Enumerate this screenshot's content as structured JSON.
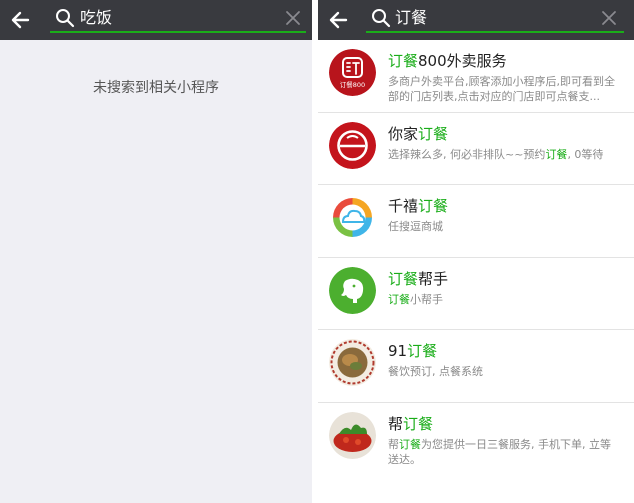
{
  "left": {
    "search": {
      "query": "吃饭"
    },
    "empty_message": "未搜索到相关小程序"
  },
  "right": {
    "search": {
      "query": "订餐"
    },
    "results": [
      {
        "title_parts": [
          "订餐",
          "800外卖服务"
        ],
        "desc_parts": [
          "多商户外卖平台,顾客添加小程序后,即可看到全部的门店列表,点击对应的门店即可点餐支..."
        ],
        "logo_text": "订餐800",
        "icon": "dingcan800-logo"
      },
      {
        "title_parts": [
          "你家",
          "订餐"
        ],
        "desc_parts": [
          "选择辣么多, 何必非排队~~预约",
          "订餐",
          ", 0等待"
        ],
        "icon": "nijia-dingcan-logo"
      },
      {
        "title_parts": [
          "千禧",
          "订餐"
        ],
        "desc_parts": [
          "任搜逗商城"
        ],
        "icon": "qianxi-cloud-logo"
      },
      {
        "title_parts": [
          "订餐",
          "帮手"
        ],
        "desc_parts": [
          "订餐",
          "小帮手"
        ],
        "icon": "elephant-logo"
      },
      {
        "title_parts": [
          "91",
          "订餐"
        ],
        "desc_parts": [
          "餐饮预订, 点餐系统"
        ],
        "icon": "food-plate-logo"
      },
      {
        "title_parts": [
          "帮",
          "订餐"
        ],
        "desc_parts": [
          "帮",
          "订餐",
          "为您提供一日三餐服务, 手机下单, 立等送达。"
        ],
        "icon": "dish-photo-logo"
      }
    ]
  },
  "colors": {
    "topbar": "#393a3f",
    "accent": "#1aad19",
    "left_background": "#efeff4"
  }
}
